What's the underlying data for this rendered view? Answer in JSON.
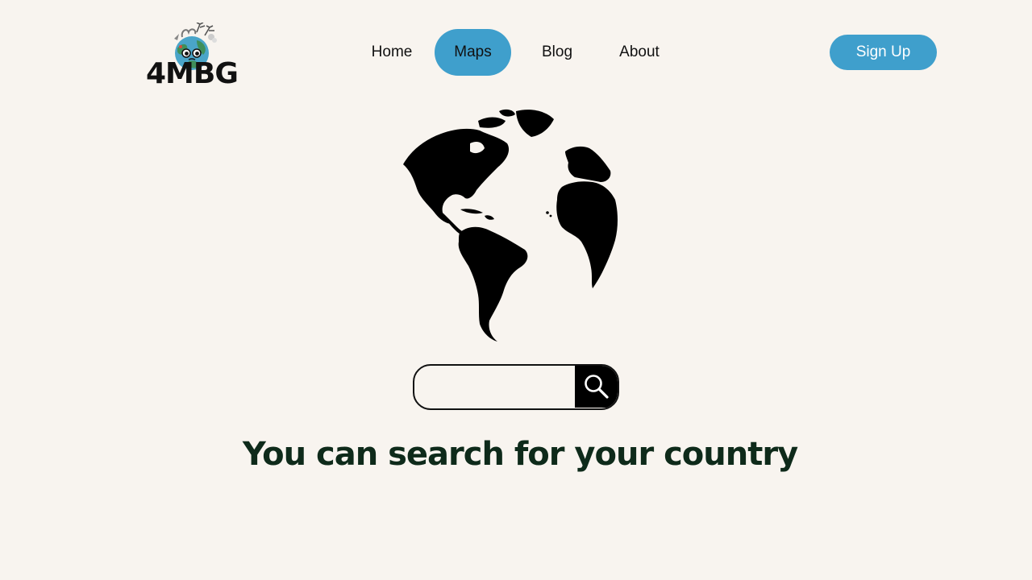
{
  "brand": {
    "logo_text": "4MBG"
  },
  "nav": {
    "items": [
      {
        "label": "Home"
      },
      {
        "label": "Maps"
      },
      {
        "label": "Blog"
      },
      {
        "label": "About"
      }
    ],
    "active": "Maps",
    "active_color": "#3f9fcc"
  },
  "header": {
    "signup_label": "Sign Up",
    "signup_color": "#3f9fcc"
  },
  "hero": {
    "illustration": "world-globe-icon",
    "heading": "You can search for your country"
  },
  "search": {
    "value": "",
    "placeholder": "",
    "button_icon": "magnifier-icon"
  }
}
